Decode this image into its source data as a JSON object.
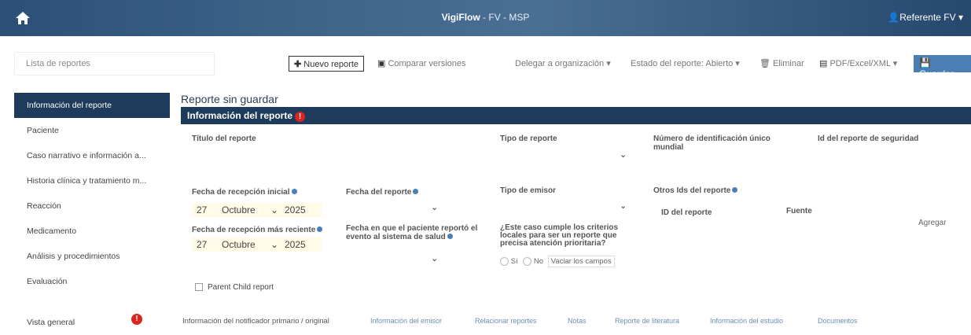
{
  "header": {
    "app_name": "VigiFlow",
    "app_sub": " - FV - MSP",
    "user": "Referente FV"
  },
  "toolbar": {
    "report_list": "Lista de reportes",
    "new_report": "Nuevo reporte",
    "compare": "Comparar versiones",
    "delegate": "Delegar a organización",
    "status": "Estado del reporte: Abierto",
    "delete": "Eliminar",
    "export": "PDF/Excel/XML",
    "save": "Guardar"
  },
  "sidebar": {
    "items": [
      {
        "label": "Información del reporte"
      },
      {
        "label": "Paciente"
      },
      {
        "label": "Caso narrativo e información a..."
      },
      {
        "label": "Historia clínica y tratamiento m..."
      },
      {
        "label": "Reacción"
      },
      {
        "label": "Medicamento"
      },
      {
        "label": "Análisis y procedimientos"
      },
      {
        "label": "Evaluación"
      },
      {
        "label": "Vista general"
      }
    ]
  },
  "main": {
    "page_title": "Reporte sin guardar",
    "section_title": "Información del reporte",
    "fields": {
      "report_title": "Título del reporte",
      "report_type": "Tipo de reporte",
      "unique_id": "Número de identificación único mundial",
      "security_id": "Id del reporte de seguridad",
      "initial_date": "Fecha de recepción inicial",
      "report_date": "Fecha del reporte",
      "sender_type": "Tipo de emisor",
      "other_ids": "Otros Ids del reporte",
      "recent_date": "Fecha de recepción más reciente",
      "patient_report_date": "Fecha en que el paciente reportó el evento al sistema de salud",
      "priority_question": "¿Este caso cumple los criterios locales para ser un reporte que precisa atención prioritaria?",
      "yes": "Sí",
      "no": "No",
      "clear_fields": "Vaciar los campos",
      "report_id_col": "ID del reporte",
      "source_col": "Fuente",
      "add": "Agregar",
      "parent_child": "Parent Child report"
    },
    "initial_date_value": {
      "day": "27",
      "month": "Octubre",
      "year": "2025"
    },
    "recent_date_value": {
      "day": "27",
      "month": "Octubre",
      "year": "2025"
    }
  },
  "tabs": [
    {
      "label": "Información del notificador primario / original"
    },
    {
      "label": "Información del emisor"
    },
    {
      "label": "Relacionar reportes"
    },
    {
      "label": "Notas"
    },
    {
      "label": "Reporte de literatura"
    },
    {
      "label": "Información del estudio"
    },
    {
      "label": "Documentos"
    }
  ]
}
